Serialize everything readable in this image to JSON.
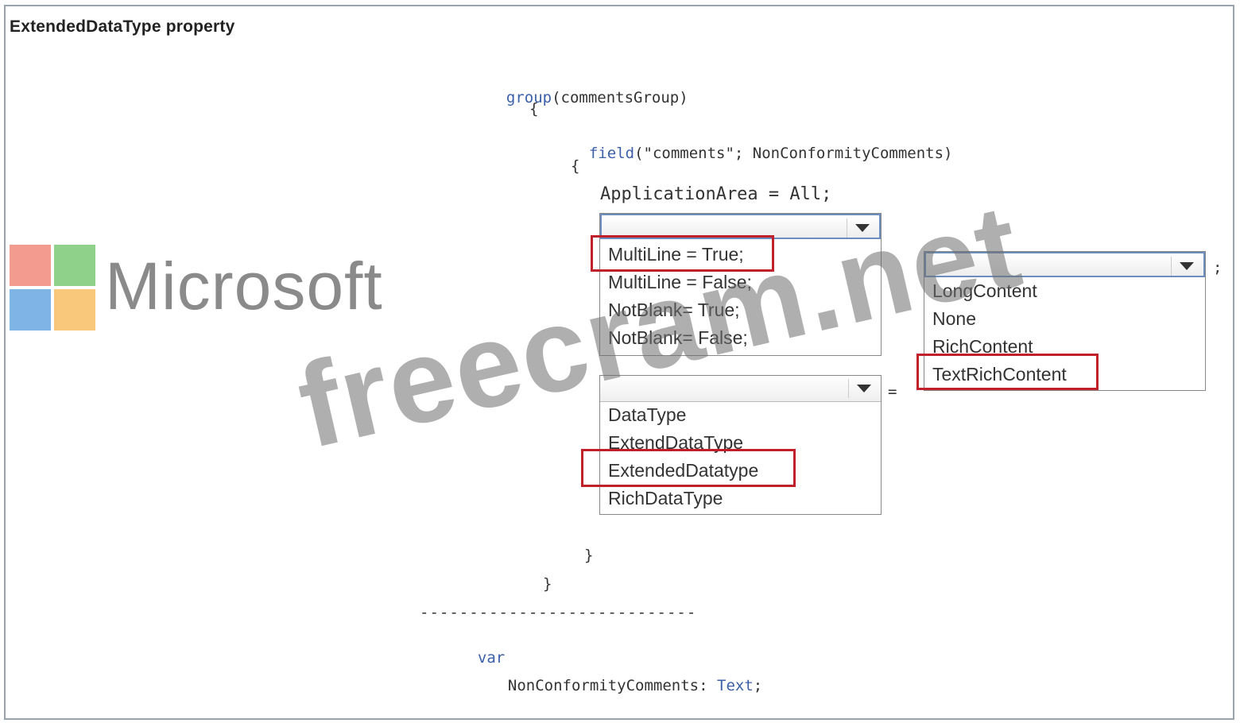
{
  "title": "ExtendedDataType property",
  "code": {
    "line1_kw": "group",
    "line1_rest": "(commentsGroup)",
    "brace_open1": "{",
    "line3_kw": "field",
    "line3_rest": "(\"comments\"; NonConformityComments)",
    "brace_open2": "{",
    "line5": "ApplicationArea = All;",
    "semicolon": ";",
    "equals": "=",
    "brace_close2": "}",
    "brace_close1": "}",
    "separator": "----------------------------",
    "var_kw": "var",
    "var_line_name": "NonConformityComments: ",
    "var_line_type": "Text",
    "var_line_end": ";"
  },
  "logo": {
    "text": "Microsoft",
    "colors": [
      "#f29b8e",
      "#8fd18a",
      "#7fb4e6",
      "#f9c87a"
    ]
  },
  "watermark": "freecram.net",
  "dropdown1": {
    "selected": "",
    "options": [
      "MultiLine = True;",
      "MultiLine = False;",
      "NotBlank= True;",
      "NotBlank= False;"
    ],
    "highlighted": "MultiLine = True;"
  },
  "dropdown2": {
    "selected": "",
    "options": [
      "DataType",
      "ExtendDataType",
      "ExtendedDatatype",
      "RichDataType"
    ],
    "highlighted": "ExtendedDatatype"
  },
  "dropdown3": {
    "selected": "",
    "options": [
      "LongContent",
      "None",
      "RichContent",
      "TextRichContent"
    ],
    "highlighted": "TextRichContent"
  },
  "highlight_color": "#c0202a"
}
